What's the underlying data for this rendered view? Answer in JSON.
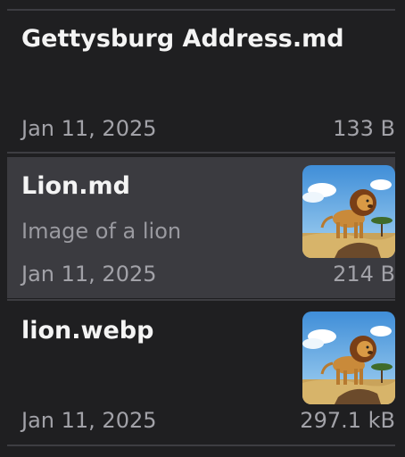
{
  "items": [
    {
      "title": "Gettysburg Address.md",
      "date": "Jan 11, 2025",
      "size": "133 B"
    },
    {
      "title": "Lion.md",
      "subtitle": "Image of a lion",
      "date": "Jan 11, 2025",
      "size": "214 B",
      "thumbnail_icon": "lion-image"
    },
    {
      "title": "lion.webp",
      "date": "Jan 11, 2025",
      "size": "297.1 kB",
      "thumbnail_icon": "lion-image"
    }
  ],
  "colors": {
    "background": "#1f1f21",
    "selected_row": "#3b3b40",
    "divider": "#3d3d42",
    "title_text": "#f4f4f4",
    "meta_text": "#a2a2a8"
  }
}
